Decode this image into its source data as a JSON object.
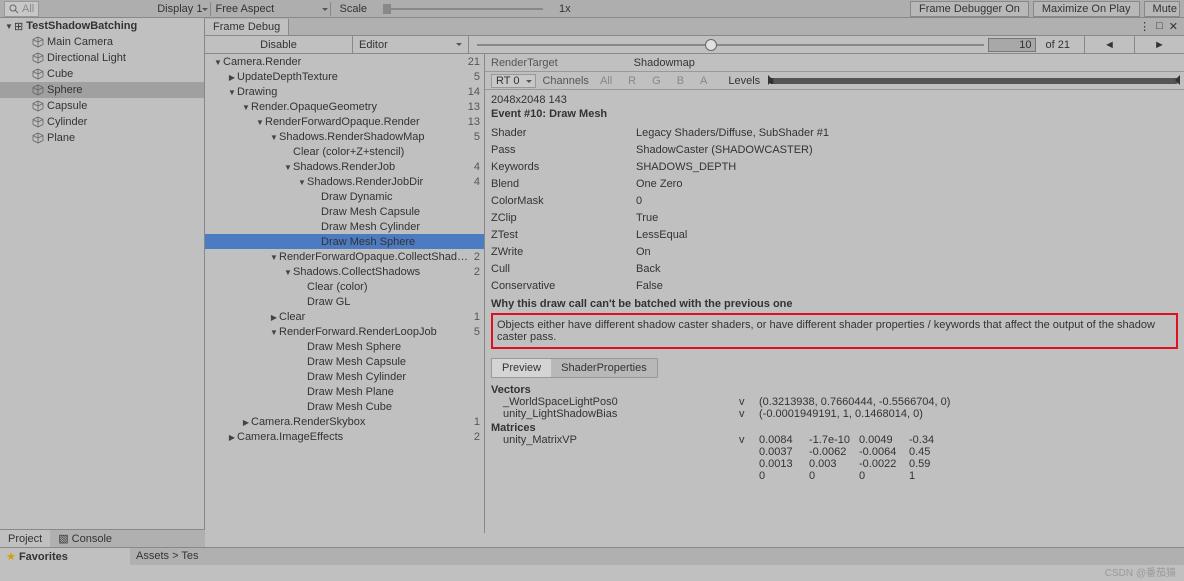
{
  "toolbar": {
    "search_placeholder": "All",
    "display": "Display 1",
    "aspect": "Free Aspect",
    "scale_label": "Scale",
    "scale_value": "1x",
    "fd_label": "Frame Debugger On",
    "max_label": "Maximize On Play",
    "mute_label": "Mute"
  },
  "hierarchy": {
    "scene": "TestShadowBatching",
    "items": [
      "Main Camera",
      "Directional Light",
      "Cube",
      "Sphere",
      "Capsule",
      "Cylinder",
      "Plane"
    ],
    "selected": "Sphere"
  },
  "frame_debug": {
    "title": "Frame Debug",
    "disable": "Disable",
    "editor": "Editor",
    "current": "10",
    "total": "of 21",
    "prev": "◄",
    "next": "►"
  },
  "tree": [
    {
      "d": 0,
      "a": "open",
      "label": "Camera.Render",
      "n": "21"
    },
    {
      "d": 1,
      "a": "closed",
      "label": "UpdateDepthTexture",
      "n": "5"
    },
    {
      "d": 1,
      "a": "open",
      "label": "Drawing",
      "n": "14"
    },
    {
      "d": 2,
      "a": "open",
      "label": "Render.OpaqueGeometry",
      "n": "13"
    },
    {
      "d": 3,
      "a": "open",
      "label": "RenderForwardOpaque.Render",
      "n": "13"
    },
    {
      "d": 4,
      "a": "open",
      "label": "Shadows.RenderShadowMap",
      "n": "5"
    },
    {
      "d": 5,
      "a": "",
      "label": "Clear (color+Z+stencil)",
      "n": ""
    },
    {
      "d": 5,
      "a": "open",
      "label": "Shadows.RenderJob",
      "n": "4"
    },
    {
      "d": 6,
      "a": "open",
      "label": "Shadows.RenderJobDir",
      "n": "4"
    },
    {
      "d": 7,
      "a": "",
      "label": "Draw Dynamic",
      "n": ""
    },
    {
      "d": 7,
      "a": "",
      "label": "Draw Mesh Capsule",
      "n": ""
    },
    {
      "d": 7,
      "a": "",
      "label": "Draw Mesh Cylinder",
      "n": ""
    },
    {
      "d": 7,
      "a": "",
      "label": "Draw Mesh Sphere",
      "n": "",
      "sel": true
    },
    {
      "d": 4,
      "a": "open",
      "label": "RenderForwardOpaque.CollectShadows",
      "n": "2"
    },
    {
      "d": 5,
      "a": "open",
      "label": "Shadows.CollectShadows",
      "n": "2"
    },
    {
      "d": 6,
      "a": "",
      "label": "Clear (color)",
      "n": ""
    },
    {
      "d": 6,
      "a": "",
      "label": "Draw GL",
      "n": ""
    },
    {
      "d": 4,
      "a": "closed",
      "label": "Clear",
      "n": "1"
    },
    {
      "d": 4,
      "a": "open",
      "label": "RenderForward.RenderLoopJob",
      "n": "5"
    },
    {
      "d": 6,
      "a": "",
      "label": "Draw Mesh Sphere",
      "n": ""
    },
    {
      "d": 6,
      "a": "",
      "label": "Draw Mesh Capsule",
      "n": ""
    },
    {
      "d": 6,
      "a": "",
      "label": "Draw Mesh Cylinder",
      "n": ""
    },
    {
      "d": 6,
      "a": "",
      "label": "Draw Mesh Plane",
      "n": ""
    },
    {
      "d": 6,
      "a": "",
      "label": "Draw Mesh Cube",
      "n": ""
    },
    {
      "d": 2,
      "a": "closed",
      "label": "Camera.RenderSkybox",
      "n": "1"
    },
    {
      "d": 1,
      "a": "closed",
      "label": "Camera.ImageEffects",
      "n": "2"
    }
  ],
  "render_target": {
    "label": "RenderTarget",
    "value": "Shadowmap",
    "rt": "RT 0",
    "channels": "Channels",
    "all": "All",
    "r": "R",
    "g": "G",
    "b": "B",
    "a": "A",
    "levels": "Levels",
    "size": "2048x2048 143"
  },
  "event": {
    "title": "Event #10: Draw Mesh",
    "props": [
      [
        "Shader",
        "Legacy Shaders/Diffuse, SubShader #1"
      ],
      [
        "Pass",
        "ShadowCaster (SHADOWCASTER)"
      ],
      [
        "Keywords",
        "SHADOWS_DEPTH"
      ],
      [
        "Blend",
        "One Zero"
      ],
      [
        "ColorMask",
        "0"
      ],
      [
        "ZClip",
        "True"
      ],
      [
        "ZTest",
        "LessEqual"
      ],
      [
        "ZWrite",
        "On"
      ],
      [
        "Cull",
        "Back"
      ],
      [
        "Conservative",
        "False"
      ]
    ],
    "batch_title": "Why this draw call can't be batched with the previous one",
    "batch_reason": "Objects either have different shadow caster shaders, or have different shader properties / keywords that affect the output of the shadow caster pass."
  },
  "tabs": {
    "preview": "Preview",
    "shaderprops": "ShaderProperties"
  },
  "vectors": {
    "title": "Vectors",
    "rows": [
      [
        "_WorldSpaceLightPos0",
        "v",
        "(0.3213938, 0.7660444, -0.5566704, 0)"
      ],
      [
        "unity_LightShadowBias",
        "v",
        "(-0.0001949191, 1, 0.1468014, 0)"
      ]
    ]
  },
  "matrices": {
    "title": "Matrices",
    "name": "unity_MatrixVP",
    "type": "v",
    "rows": [
      [
        "0.0084",
        "-1.7e-10",
        "0.0049",
        "-0.34"
      ],
      [
        "0.0037",
        "-0.0062",
        "-0.0064",
        "0.45"
      ],
      [
        "0.0013",
        "0.003",
        "-0.0022",
        "0.59"
      ],
      [
        "0",
        "0",
        "0",
        "1"
      ]
    ]
  },
  "bottom": {
    "project": "Project",
    "console": "Console",
    "favorites": "Favorites",
    "assets": "Assets",
    "path": "Tes"
  },
  "watermark": "CSDN @番茄猿"
}
